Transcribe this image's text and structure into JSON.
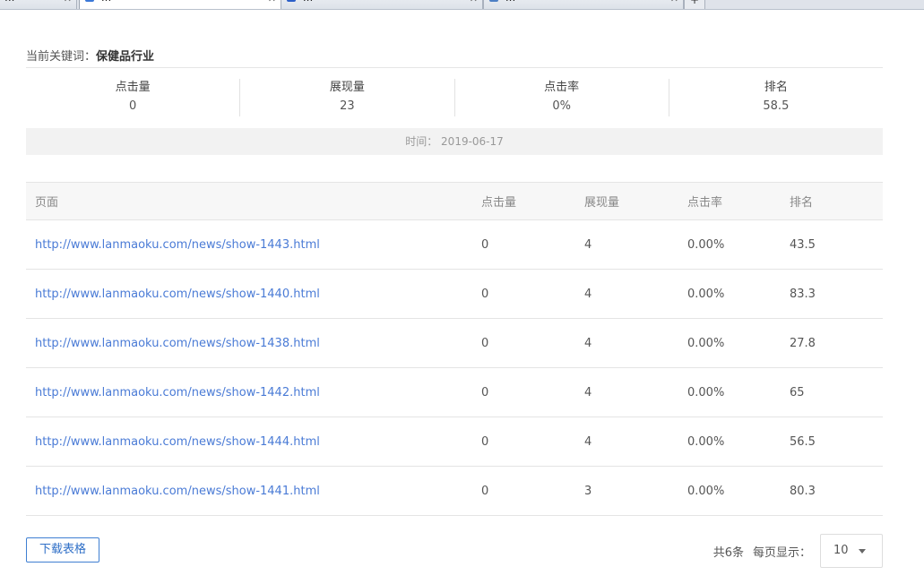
{
  "browser": {
    "tabs": [
      {
        "label": "..."
      },
      {
        "label": "..."
      },
      {
        "label": "..."
      },
      {
        "label": "..."
      }
    ],
    "new_tab_label": "+"
  },
  "keyword": {
    "label": "当前关键词：",
    "value": "保健品行业"
  },
  "stats": [
    {
      "label": "点击量",
      "value": "0"
    },
    {
      "label": "展现量",
      "value": "23"
    },
    {
      "label": "点击率",
      "value": "0%"
    },
    {
      "label": "排名",
      "value": "58.5"
    }
  ],
  "time": {
    "label": "时间：",
    "value": "2019-06-17"
  },
  "table": {
    "headers": {
      "page": "页面",
      "click": "点击量",
      "show": "展现量",
      "rate": "点击率",
      "rank": "排名"
    },
    "rows": [
      {
        "page": "http://www.lanmaoku.com/news/show-1443.html",
        "click": "0",
        "show": "4",
        "rate": "0.00%",
        "rank": "43.5"
      },
      {
        "page": "http://www.lanmaoku.com/news/show-1440.html",
        "click": "0",
        "show": "4",
        "rate": "0.00%",
        "rank": "83.3"
      },
      {
        "page": "http://www.lanmaoku.com/news/show-1438.html",
        "click": "0",
        "show": "4",
        "rate": "0.00%",
        "rank": "27.8"
      },
      {
        "page": "http://www.lanmaoku.com/news/show-1442.html",
        "click": "0",
        "show": "4",
        "rate": "0.00%",
        "rank": "65"
      },
      {
        "page": "http://www.lanmaoku.com/news/show-1444.html",
        "click": "0",
        "show": "4",
        "rate": "0.00%",
        "rank": "56.5"
      },
      {
        "page": "http://www.lanmaoku.com/news/show-1441.html",
        "click": "0",
        "show": "3",
        "rate": "0.00%",
        "rank": "80.3"
      }
    ]
  },
  "footer": {
    "download_label": "下载表格",
    "total": "共6条",
    "page_size_label": "每页显示：",
    "page_size_value": "10"
  },
  "colors": {
    "link": "#4a7bd6",
    "button_border": "#3f7fd2"
  }
}
